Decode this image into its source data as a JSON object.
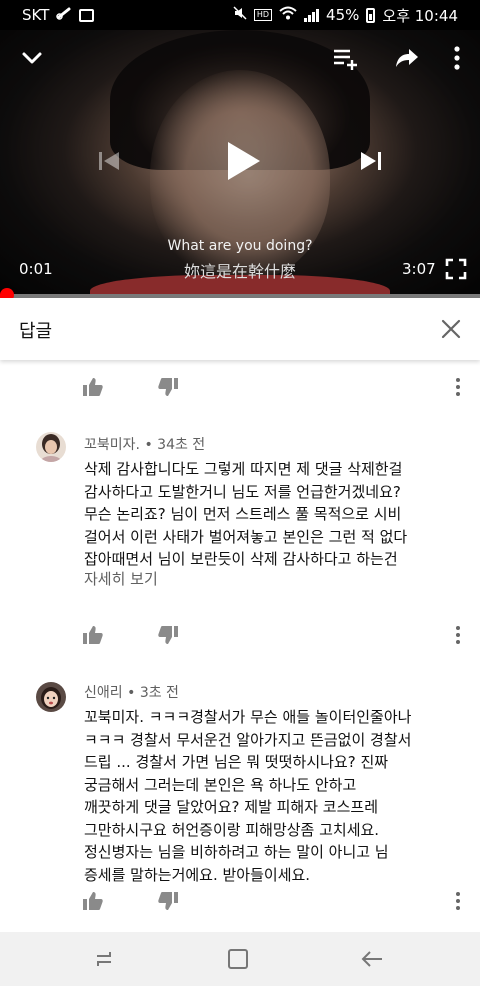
{
  "status_bar": {
    "carrier": "SKT",
    "battery": "45%",
    "time": "오후 10:44",
    "hd_label": "HD",
    "icons": [
      "link-icon",
      "image-icon",
      "mute-icon",
      "wifi-icon",
      "signal-icon",
      "battery-icon"
    ]
  },
  "player": {
    "current_time": "0:01",
    "duration": "3:07",
    "progress": 0.005,
    "subtitle_en": "What are you doing?",
    "subtitle_zh": "妳這是在幹什麼",
    "icons": [
      "chevron-down-icon",
      "add-to-queue-icon",
      "share-icon",
      "more-vert-icon",
      "previous-icon",
      "play-icon",
      "next-icon",
      "fullscreen-icon"
    ]
  },
  "replies_panel": {
    "title": "답글"
  },
  "comments": [
    {
      "author": "꼬북미자.",
      "time": "34초 전",
      "lines": [
        "삭제 감사합니다도 그렇게 따지면 제 댓글 삭제한걸",
        "감사하다고 도발한거니 님도 저를 언급한거겠네요?",
        "무슨 논리죠? 님이 먼저 스트레스 풀 목적으로 시비",
        "걸어서 이런 사태가 벌어져놓고 본인은 그런 적 없다",
        "잡아때면서 님이 보란듯이 삭제 감사하다고 하는건"
      ],
      "read_more": "자세히 보기"
    },
    {
      "author": "신애리",
      "time": "3초 전",
      "lines": [
        "꼬북미자. ㅋㅋㅋ경찰서가 무슨 애들 놀이터인줄아나",
        "ㅋㅋㅋ 경찰서 무서운건 알아가지고 뜬금없이 경찰서",
        "드립 ... 경찰서 가면 님은 뭐 떳떳하시나요? 진짜",
        "궁금해서 그러는데 본인은 욕 하나도 안하고",
        "깨끗하게 댓글 달았어요? 제발 피해자 코스프레",
        "그만하시구요 허언증이랑 피해망상좀 고치세요.",
        "정신병자는 님을 비하하려고 하는 말이 아니고 님",
        "증세를 말하는거에요. 받아들이세요."
      ]
    }
  ],
  "colors": {
    "accent": "#ff0000",
    "meta_text": "#606060",
    "nav_bar": "#f1f1f1"
  }
}
